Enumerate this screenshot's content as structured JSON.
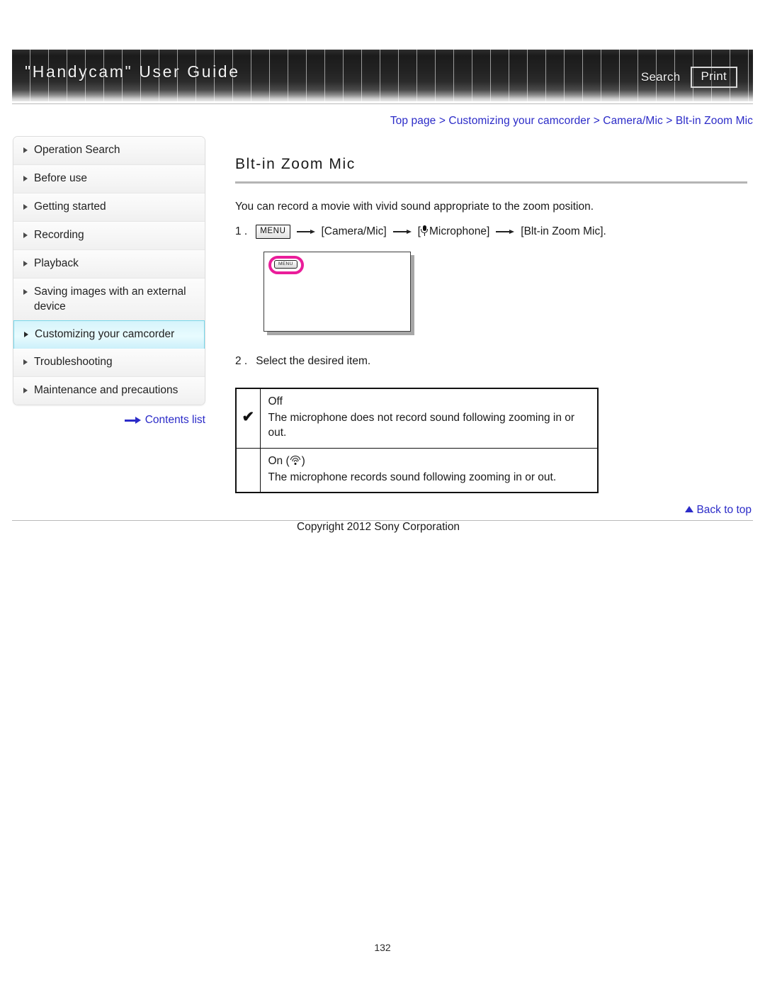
{
  "header": {
    "site_title": "\"Handycam\" User Guide",
    "search_label": "Search",
    "print_label": "Print"
  },
  "breadcrumb": {
    "items": [
      "Top page",
      "Customizing your camcorder",
      "Camera/Mic",
      "Blt-in Zoom Mic"
    ],
    "separator": ">"
  },
  "sidebar": {
    "items": [
      {
        "label": "Operation Search",
        "active": false
      },
      {
        "label": "Before use",
        "active": false
      },
      {
        "label": "Getting started",
        "active": false
      },
      {
        "label": "Recording",
        "active": false
      },
      {
        "label": "Playback",
        "active": false
      },
      {
        "label": "Saving images with an external device",
        "active": false
      },
      {
        "label": "Customizing your camcorder",
        "active": true
      },
      {
        "label": "Troubleshooting",
        "active": false
      },
      {
        "label": "Maintenance and precautions",
        "active": false
      }
    ],
    "contents_link_label": "Contents list"
  },
  "main": {
    "heading": "Blt-in Zoom Mic",
    "intro": "You can record a movie with vivid sound appropriate to the zoom position.",
    "step1": {
      "number": "1 .",
      "menu_chip_label": "MENU",
      "item1": "[Camera/Mic]",
      "item2_prefix": "[",
      "item2": "Microphone]",
      "item3": "[Blt-in Zoom Mic]."
    },
    "screenshot": {
      "menu_chip_label": "MENU"
    },
    "step2": {
      "number": "2 .",
      "text": "Select the desired item."
    },
    "options": [
      {
        "checked": true,
        "check_glyph": "✔",
        "name": "Off",
        "description": "The microphone does not record sound following zooming in or out."
      },
      {
        "checked": false,
        "check_glyph": "",
        "name_prefix": "On (",
        "name_suffix": ")",
        "name": "On",
        "description": "The microphone records sound following zooming in or out."
      }
    ]
  },
  "footer": {
    "back_to_top": "Back to top",
    "copyright": "Copyright 2012 Sony Corporation",
    "page_number": "132"
  },
  "colors": {
    "link_blue": "#2b2bc8",
    "highlight_magenta": "#ea1d9a",
    "active_nav_border": "#77d7ea"
  }
}
